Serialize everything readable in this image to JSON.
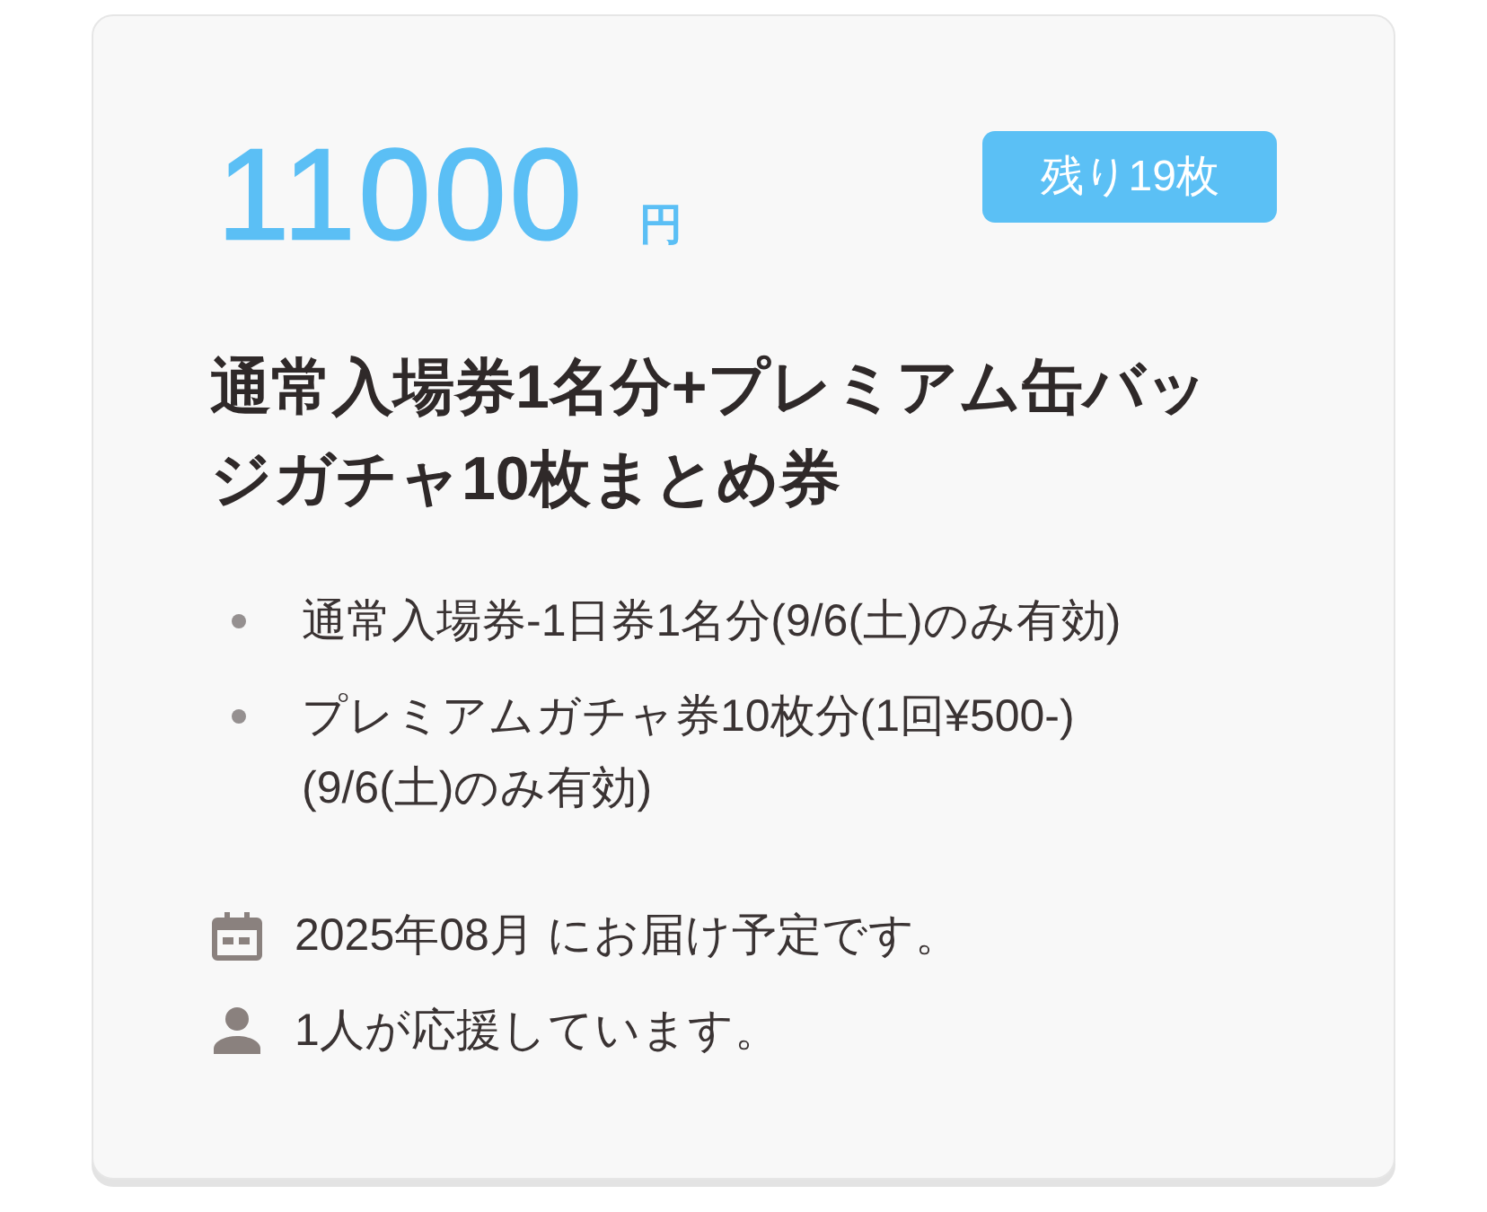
{
  "price": {
    "amount": "11000",
    "unit": "円"
  },
  "badge": {
    "label": "残り19枚"
  },
  "title": "通常入場券1名分+プレミアム缶バッジガチャ10枚まとめ券",
  "items": [
    "通常入場券-1日券1名分(9/6(土)のみ有効)",
    "プレミアムガチャ券10枚分(1回¥500-)(9/6(土)のみ有効)"
  ],
  "info": [
    {
      "kind": "calendar",
      "text": "2025年08月 にお届け予定です。"
    },
    {
      "kind": "person",
      "text": "1人が応援しています。"
    }
  ]
}
